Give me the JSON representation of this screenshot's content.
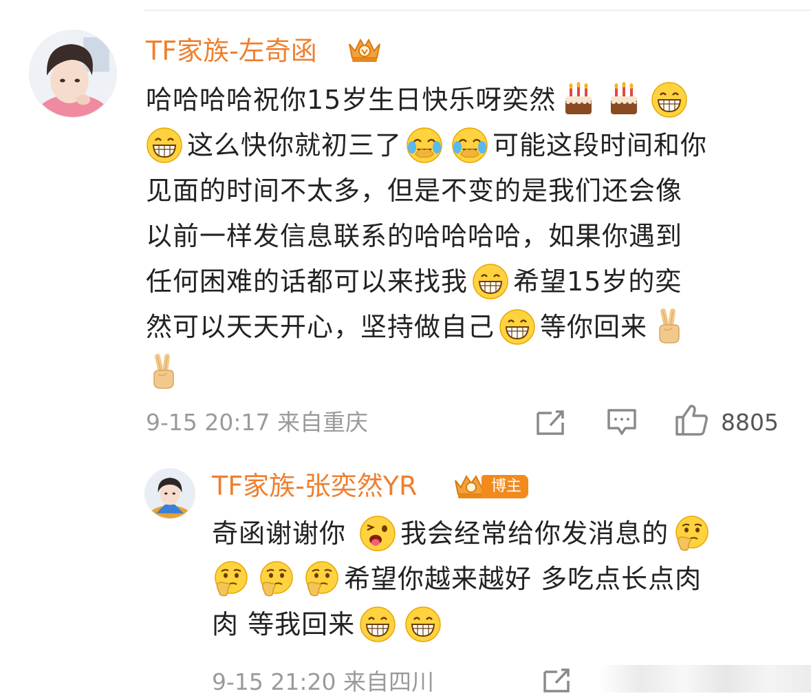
{
  "comment": {
    "username": "TF家族-左奇函",
    "lines": [
      [
        "哈哈哈哈祝你15岁生日快乐呀奕然",
        "[cake]",
        "[cake]",
        "[grin]"
      ],
      [
        "[grin]",
        "这么快你就初三了",
        "[cry]",
        "[cry]",
        "可能这段时间和你"
      ],
      [
        "见面的时间不太多，但是不变的是我们还会像"
      ],
      [
        "以前一样发信息联系的哈哈哈哈，如果你遇到"
      ],
      [
        "任何困难的话都可以来找我",
        "[grin]",
        "希望15岁的奕"
      ],
      [
        "然可以天天开心，坚持做自己",
        "[grin]",
        "等你回来",
        "[victory]"
      ],
      [
        "[victory]"
      ]
    ],
    "meta": "9-15 20:17 来自重庆",
    "like_count": "8805"
  },
  "reply": {
    "username": "TF家族-张奕然YR",
    "author_badge": "博主",
    "lines": [
      [
        "奇函谢谢你 ",
        "[wink]",
        "我会经常给你发消息的",
        "[think]"
      ],
      [
        "[think]",
        "[think]",
        "[think]",
        "希望你越来越好 多吃点长点肉"
      ],
      [
        "肉 等我回来",
        "[grin]",
        "[grin]"
      ]
    ],
    "meta": "9-15 21:20 来自四川"
  },
  "icons": {
    "share": "share-icon",
    "comment": "comment-icon",
    "like": "thumbs-up-icon",
    "crown": "crown-badge-icon"
  },
  "colors": {
    "username": "#ef7f2f",
    "badge": "#f28a1c",
    "text": "#222222",
    "meta": "#9a9a9a"
  }
}
